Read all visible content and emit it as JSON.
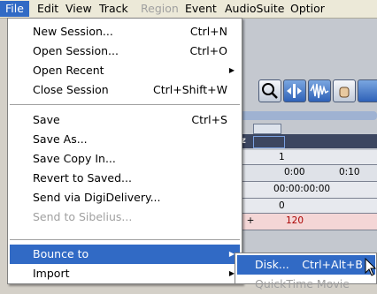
{
  "menubar": {
    "items": [
      {
        "label": "File"
      },
      {
        "label": "Edit"
      },
      {
        "label": "View"
      },
      {
        "label": "Track"
      },
      {
        "label": "Region"
      },
      {
        "label": "Event"
      },
      {
        "label": "AudioSuite"
      },
      {
        "label": "Optior"
      }
    ]
  },
  "file_menu": {
    "items": [
      {
        "label": "New Session...",
        "shortcut": "Ctrl+N"
      },
      {
        "label": "Open Session...",
        "shortcut": "Ctrl+O"
      },
      {
        "label": "Open Recent",
        "shortcut": ""
      },
      {
        "label": "Close Session",
        "shortcut": "Ctrl+Shift+W"
      },
      {
        "label": "Save",
        "shortcut": "Ctrl+S"
      },
      {
        "label": "Save As...",
        "shortcut": ""
      },
      {
        "label": "Save Copy In...",
        "shortcut": ""
      },
      {
        "label": "Revert to Saved...",
        "shortcut": ""
      },
      {
        "label": "Send via DigiDelivery...",
        "shortcut": ""
      },
      {
        "label": "Send to Sibelius...",
        "shortcut": ""
      },
      {
        "label": "Bounce to",
        "shortcut": ""
      },
      {
        "label": "Import",
        "shortcut": ""
      }
    ]
  },
  "bounce_submenu": {
    "items": [
      {
        "label": "Disk...",
        "shortcut": "Ctrl+Alt+B"
      },
      {
        "label": "QuickTime Movie",
        "shortcut": ""
      }
    ]
  },
  "edit_window": {
    "toolbar_label": "z",
    "ruler": {
      "bars": "1",
      "min_secs_a": "0:00",
      "min_secs_b": "0:10",
      "timecode": "00:00:00:00",
      "samples": "0",
      "tempo": "120"
    }
  },
  "colors": {
    "highlight": "#316ac5",
    "menu_bg": "#ffffff",
    "menubar_bg": "#ece9d8"
  }
}
